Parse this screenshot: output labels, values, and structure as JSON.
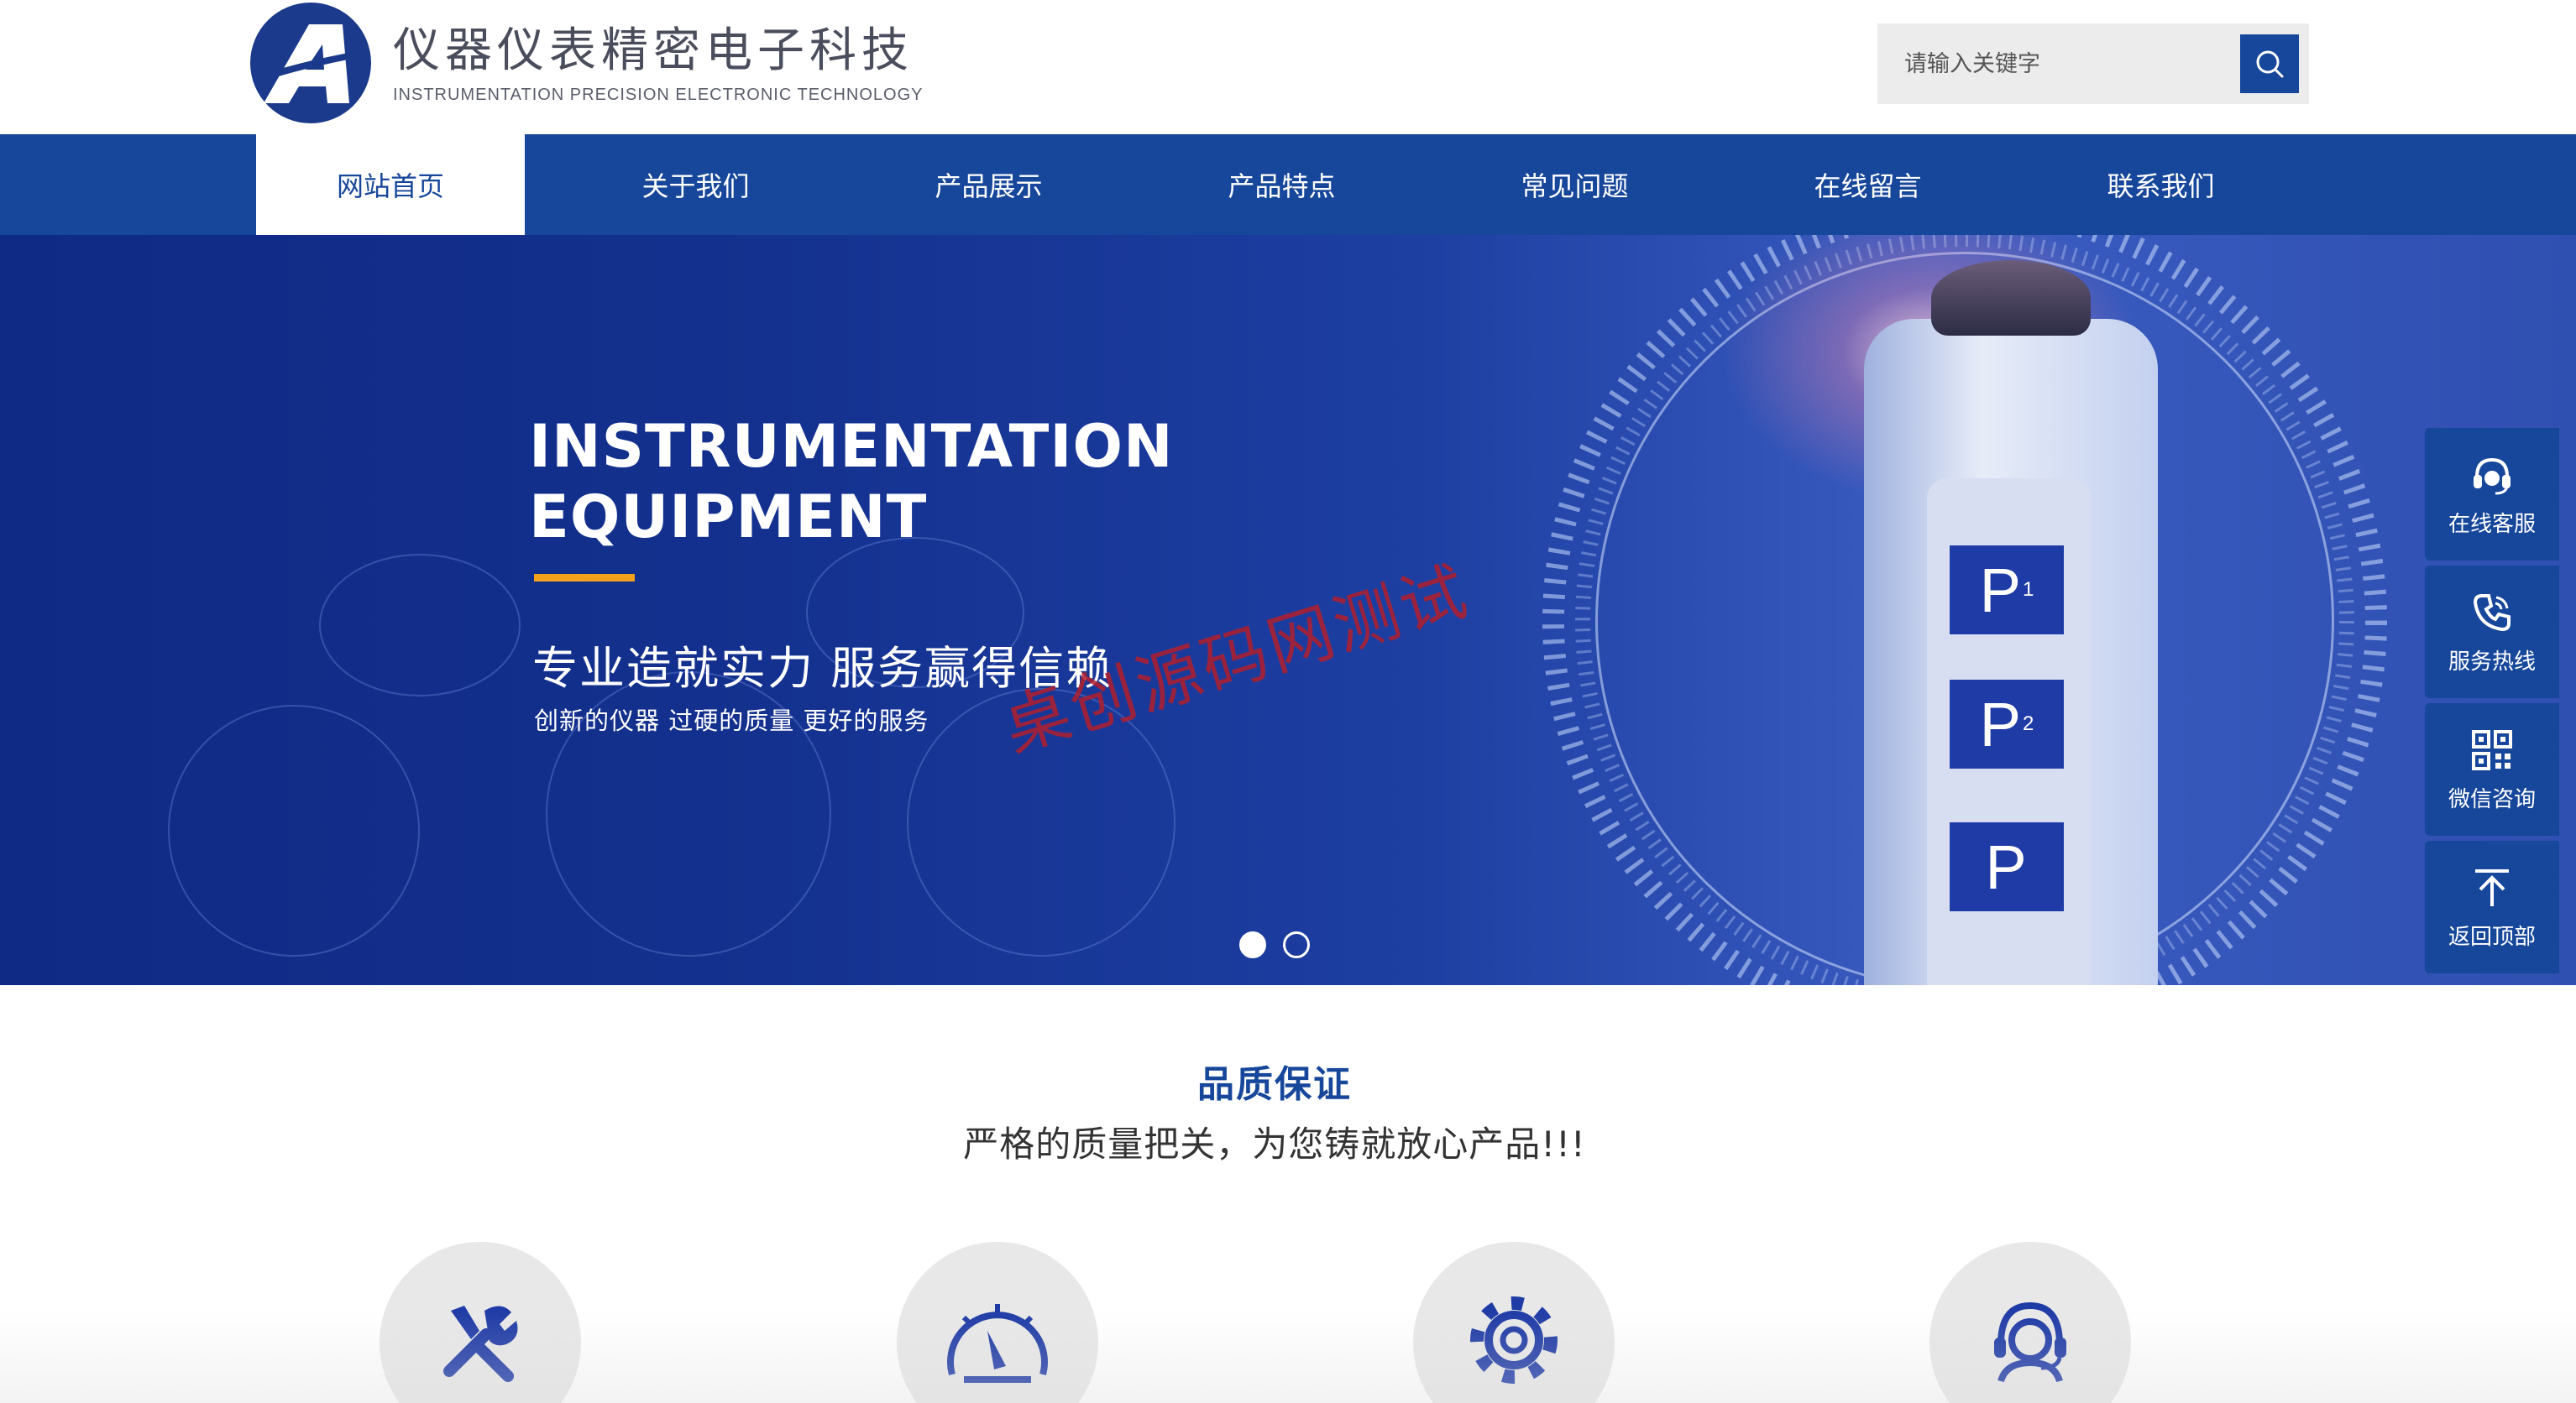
{
  "brand": {
    "name_cn": "仪器仪表精密电子科技",
    "name_en": "INSTRUMENTATION PRECISION ELECTRONIC TECHNOLOGY",
    "color": "#17479a"
  },
  "search": {
    "placeholder": "请输入关键字"
  },
  "nav": {
    "items": [
      {
        "label": "网站首页"
      },
      {
        "label": "关于我们"
      },
      {
        "label": "产品展示"
      },
      {
        "label": "产品特点"
      },
      {
        "label": "常见问题"
      },
      {
        "label": "在线留言"
      },
      {
        "label": "联系我们"
      }
    ],
    "active_index": 0
  },
  "banner": {
    "title_line1": "INSTRUMENTATION",
    "title_line2": "EQUIPMENT",
    "slogan": "专业造就实力 服务赢得信赖",
    "subtitle": "创新的仪器 过硬的质量 更好的服务",
    "watermark": "桌创源码网测试",
    "accent_color": "#f4a21b",
    "slide_count": 2,
    "active_slide": 1,
    "keys": [
      "P",
      "P",
      "P"
    ],
    "key_subs": [
      "1",
      "2",
      ""
    ]
  },
  "side_bar": {
    "items": [
      {
        "label": "在线客服",
        "icon": "headset-icon"
      },
      {
        "label": "服务热线",
        "icon": "phone-icon"
      },
      {
        "label": "微信咨询",
        "icon": "qr-code-icon"
      },
      {
        "label": "返回顶部",
        "icon": "back-to-top-icon"
      }
    ]
  },
  "quality": {
    "title": "品质保证",
    "subtitle": "严格的质量把关，为您铸就放心产品!!!",
    "features": [
      {
        "icon": "tools-icon"
      },
      {
        "icon": "gauge-icon"
      },
      {
        "icon": "gear-icon"
      },
      {
        "icon": "support-agent-icon"
      }
    ]
  }
}
